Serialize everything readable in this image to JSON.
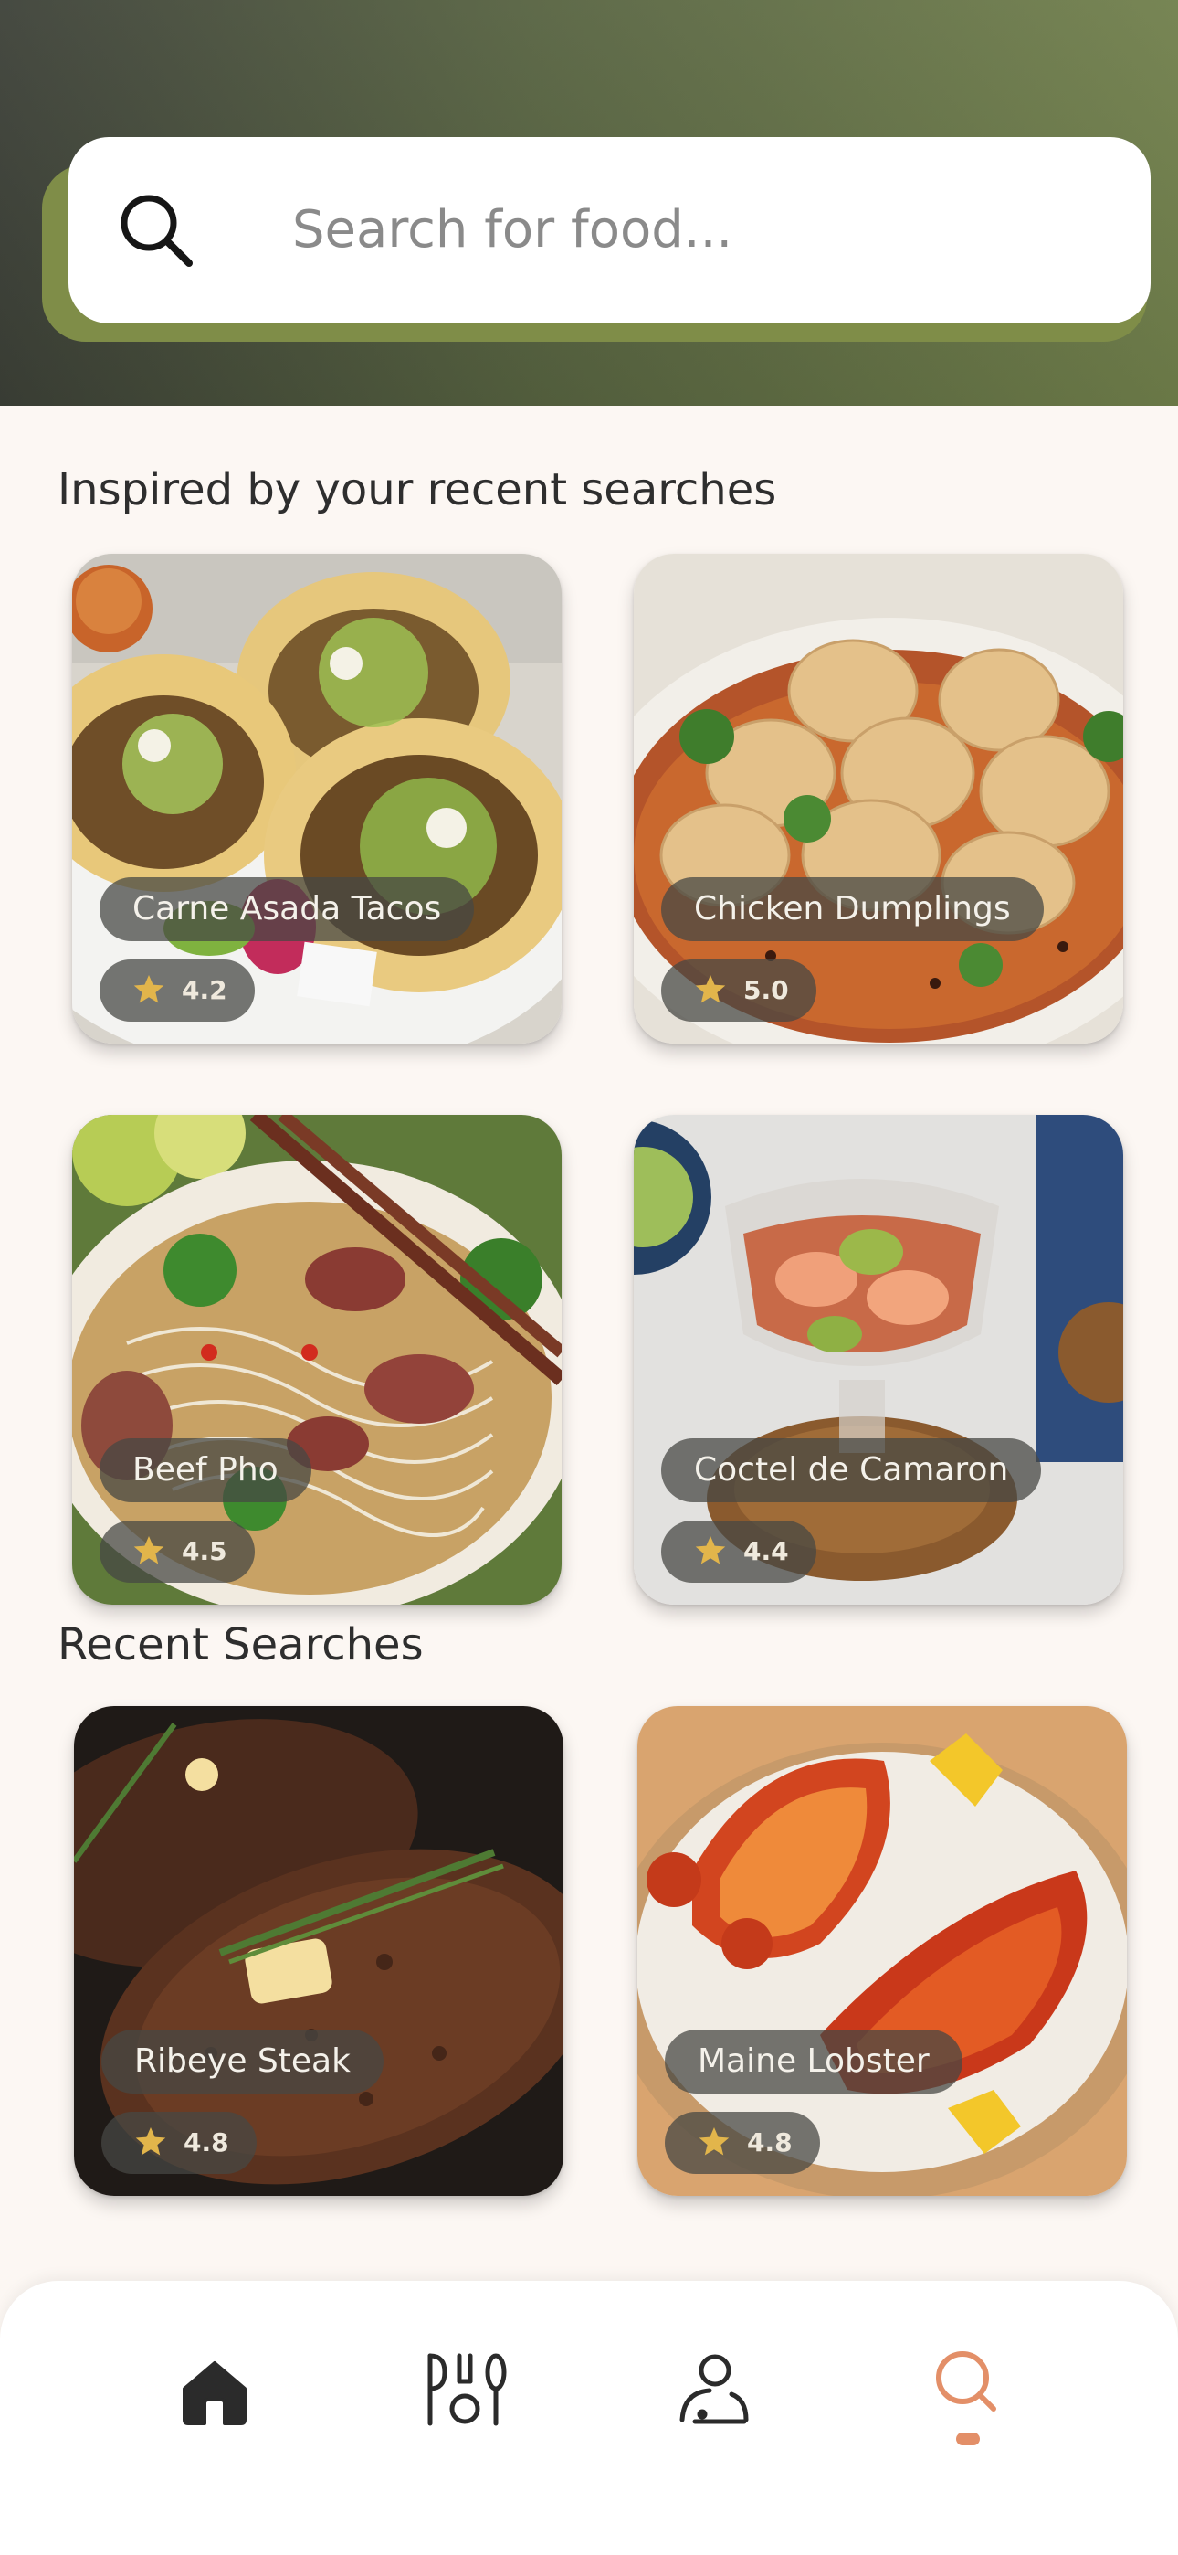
{
  "search": {
    "placeholder": "Search for food..."
  },
  "sections": {
    "inspired_title": "Inspired by your recent searches",
    "recent_title": "Recent Searches"
  },
  "inspired": [
    {
      "name": "Carne Asada Tacos",
      "rating": "4.2"
    },
    {
      "name": "Chicken Dumplings",
      "rating": "5.0"
    },
    {
      "name": "Beef Pho",
      "rating": "4.5"
    },
    {
      "name": "Coctel de Camaron",
      "rating": "4.4"
    }
  ],
  "recent": [
    {
      "name": "Ribeye Steak",
      "rating": "4.8"
    },
    {
      "name": "Maine Lobster",
      "rating": "4.8"
    }
  ],
  "nav": {
    "items": [
      "home-icon",
      "restaurant-utensils-icon",
      "profile-icon",
      "search-icon"
    ],
    "active": "search-icon"
  },
  "colors": {
    "header_start": "#3b3f36",
    "header_end": "#6f7e4a",
    "accent_olive": "#7f8d48",
    "active_nav": "#e38f68",
    "star": "#e2b54b"
  }
}
